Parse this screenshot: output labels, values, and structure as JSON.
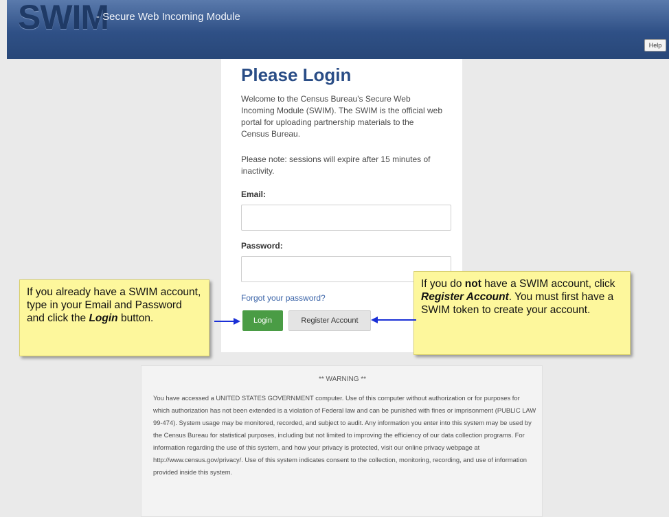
{
  "header": {
    "logo": "SWIM",
    "subtitle": "- Secure Web Incoming Module",
    "help_label": "Help"
  },
  "login": {
    "title": "Please Login",
    "welcome": "Welcome to the Census Bureau's Secure Web Incoming Module (SWIM). The SWIM is the official web portal for uploading partnership materials to the Census Bureau.",
    "note": "Please note: sessions will expire after 15 minutes of inactivity.",
    "email_label": "Email:",
    "email_value": "",
    "password_label": "Password:",
    "password_value": "",
    "forgot_link": "Forgot your password?",
    "login_button": "Login",
    "register_button": "Register Account"
  },
  "callouts": {
    "left": {
      "part1": "If you already have a SWIM account, type in your Email and Password and click the ",
      "emph": "Login",
      "part2": " button."
    },
    "right": {
      "part1": "If you do ",
      "bold": "not",
      "part2": " have a SWIM account, click ",
      "emph": "Register Account",
      "part3": ". You must first have a SWIM token to create your account."
    }
  },
  "warning": {
    "title": "** WARNING **",
    "body": "You have accessed a UNITED STATES GOVERNMENT computer. Use of this computer without authorization or for purposes for which authorization has not been extended is a violation of Federal law and can be punished with fines or imprisonment (PUBLIC LAW 99-474). System usage may be monitored, recorded, and subject to audit. Any information you enter into this system may be used by the Census Bureau for statistical purposes, including but not limited to improving the efficiency of our data collection programs. For information regarding the use of this system, and how your privacy is protected, visit our online privacy webpage at http://www.census.gov/privacy/. Use of this system indicates consent to the collection, monitoring, recording, and use of information provided inside this system."
  },
  "colors": {
    "header": "#2f5086",
    "title": "#2a4d86",
    "login_button": "#4a9c45",
    "callout": "#fdf79c",
    "arrow": "#1a2fd6"
  }
}
